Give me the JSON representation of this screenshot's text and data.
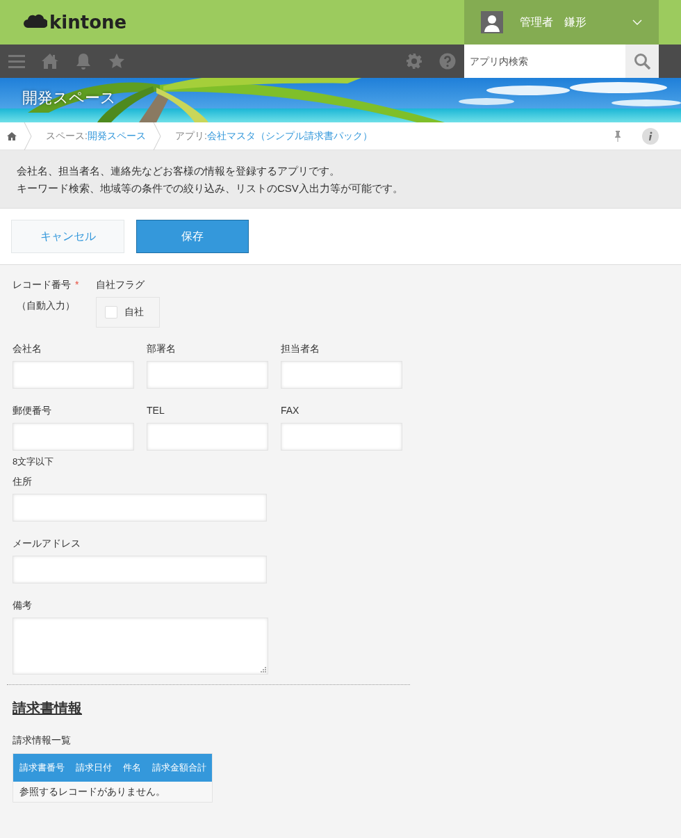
{
  "header": {
    "logo": "kintone",
    "user_name": "管理者　鎌形"
  },
  "toolbar": {
    "search": {
      "placeholder": "アプリ内検索"
    }
  },
  "banner": {
    "title": "開発スペース"
  },
  "breadcrumb": [
    {
      "prefix": "スペース: ",
      "link": "開発スペース"
    },
    {
      "prefix": "アプリ: ",
      "link": "会社マスタ（シンプル請求書パック）"
    }
  ],
  "description": [
    "会社名、担当者名、連絡先などお客様の情報を登録するアプリです。",
    "キーワード検索、地域等の条件での絞り込み、リストのCSV入出力等が可能です。"
  ],
  "buttons": [
    {
      "label": "キャンセル",
      "kind": "secondary"
    },
    {
      "label": "保存",
      "kind": "primary"
    }
  ],
  "record_number": {
    "label": "レコード番号",
    "required_mark": "*",
    "value": "（自動入力）"
  },
  "flag": {
    "label": "自社フラグ",
    "options": [
      {
        "label": "自社",
        "checked": false
      }
    ]
  },
  "field_rows": [
    [
      {
        "label": "会社名",
        "kind": "text"
      },
      {
        "label": "部署名",
        "kind": "text"
      },
      {
        "label": "担当者名",
        "kind": "text"
      }
    ],
    [
      {
        "label": "郵便番号",
        "kind": "text",
        "hint": "8文字以下"
      },
      {
        "label": "TEL",
        "kind": "text"
      },
      {
        "label": "FAX",
        "kind": "text"
      }
    ],
    [
      {
        "label": "住所",
        "kind": "wide"
      }
    ],
    [
      {
        "label": "メールアドレス",
        "kind": "wide"
      }
    ],
    [
      {
        "label": "備考",
        "kind": "textarea"
      }
    ]
  ],
  "section": {
    "title": "請求書情報",
    "table_label": "請求情報一覧",
    "columns": [
      "請求書番号",
      "請求日付",
      "件名",
      "請求金額合計"
    ],
    "empty_message": "参照するレコードがありません。"
  }
}
